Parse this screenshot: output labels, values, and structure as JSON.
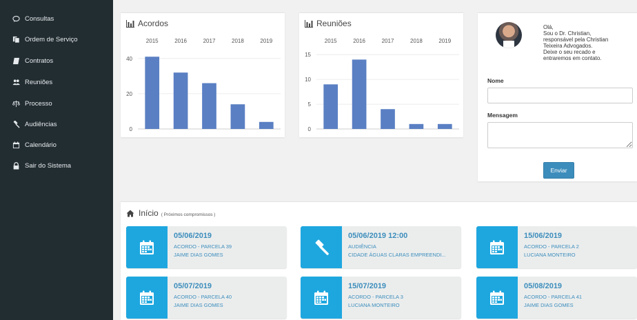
{
  "sidebar": {
    "items": [
      {
        "label": "Consultas",
        "icon": "chat-icon"
      },
      {
        "label": "Ordem de Serviço",
        "icon": "copy-icon"
      },
      {
        "label": "Contratos",
        "icon": "book-icon"
      },
      {
        "label": "Reuniões",
        "icon": "users-icon"
      },
      {
        "label": "Processo",
        "icon": "scale-icon"
      },
      {
        "label": "Audiências",
        "icon": "gavel-icon"
      },
      {
        "label": "Calendário",
        "icon": "calendar-icon"
      },
      {
        "label": "Sair do Sistema",
        "icon": "lock-icon"
      }
    ]
  },
  "chart_data": [
    {
      "type": "bar",
      "title": "Acordos",
      "categories": [
        "2015",
        "2016",
        "2017",
        "2018",
        "2019"
      ],
      "values": [
        41,
        32,
        26,
        14,
        4
      ],
      "ylim": [
        0,
        45
      ],
      "yticks": [
        0,
        20,
        40
      ],
      "grid": true,
      "color": "#5a7fc3"
    },
    {
      "type": "bar",
      "title": "Reuniões",
      "categories": [
        "2015",
        "2016",
        "2017",
        "2018",
        "2019"
      ],
      "values": [
        9,
        14,
        4,
        1,
        1
      ],
      "ylim": [
        0,
        16
      ],
      "yticks": [
        0,
        5,
        10,
        15
      ],
      "grid": true,
      "color": "#5a7fc3"
    }
  ],
  "contact": {
    "greeting_lines": [
      "Olá,",
      "Sou o Dr. Christian,",
      "responsável pela Christian",
      "Teixeira Advogados.",
      "Deixe o seu recado e",
      "entraremos em contato."
    ],
    "name_label": "Nome",
    "name_value": "",
    "message_label": "Mensagem",
    "message_value": "",
    "send_label": "Enviar"
  },
  "agenda": {
    "title": "Início",
    "subtitle": "( Próximos compromissos )",
    "items": [
      {
        "date": "05/06/2019",
        "line1": "ACORDO - PARCELA 39",
        "line2": "JAIME DIAS GOMES",
        "icon": "calendar-icon"
      },
      {
        "date": "05/06/2019 12:00",
        "line1": "AUDIÊNCIA",
        "line2": "CIDADE ÁGUAS CLARAS EMPREENDI...",
        "icon": "gavel-icon"
      },
      {
        "date": "15/06/2019",
        "line1": "ACORDO - PARCELA 2",
        "line2": "LUCIANA MONTEIRO",
        "icon": "calendar-icon"
      },
      {
        "date": "05/07/2019",
        "line1": "ACORDO - PARCELA 40",
        "line2": "JAIME DIAS GOMES",
        "icon": "calendar-icon"
      },
      {
        "date": "15/07/2019",
        "line1": "ACORDO - PARCELA 3",
        "line2": "LUCIANA MONTEIRO",
        "icon": "calendar-icon"
      },
      {
        "date": "05/08/2019",
        "line1": "ACORDO - PARCELA 41",
        "line2": "JAIME DIAS GOMES",
        "icon": "calendar-icon"
      }
    ]
  }
}
